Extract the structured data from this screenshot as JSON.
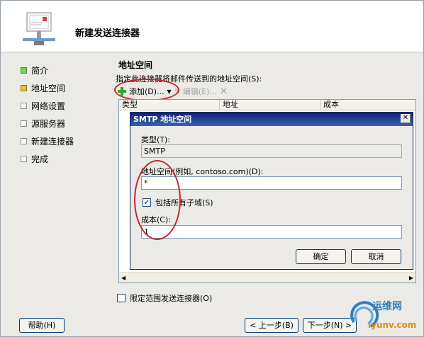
{
  "wizard": {
    "title": "新建发送连接器",
    "nav": [
      {
        "label": "简介",
        "state": "done"
      },
      {
        "label": "地址空间",
        "state": "current"
      },
      {
        "label": "网络设置",
        "state": "pending"
      },
      {
        "label": "源服务器",
        "state": "pending"
      },
      {
        "label": "新建连接器",
        "state": "pending"
      },
      {
        "label": "完成",
        "state": "pending"
      }
    ],
    "section_title": "地址空间",
    "section_desc": "指定此连接器将邮件传送到的地址空间(S):",
    "toolbar": {
      "add": "添加(D)...",
      "edit": "编辑(E)..."
    },
    "columns": [
      "类型",
      "地址",
      "成本"
    ],
    "limit_scope": "限定范围发送连接器(O)",
    "help": "帮助(H)",
    "back": "< 上一步(B)",
    "next": "下一步(N) >"
  },
  "dialog": {
    "title": "SMTP 地址空间",
    "type_label": "类型(T):",
    "type_value": "SMTP",
    "address_label": "地址空间(例如, contoso.com)(D):",
    "address_value": "*",
    "include_subdomains": "包括所有子域(S)",
    "cost_label": "成本(C):",
    "cost_value": "1",
    "ok": "确定",
    "cancel": "取消"
  },
  "watermark": {
    "line1": "运维网",
    "line2": "iyunv.com"
  },
  "colors": {
    "title_bar": "#0a246a",
    "highlight": "#c3262a",
    "add_icon": "#2fa52f"
  }
}
